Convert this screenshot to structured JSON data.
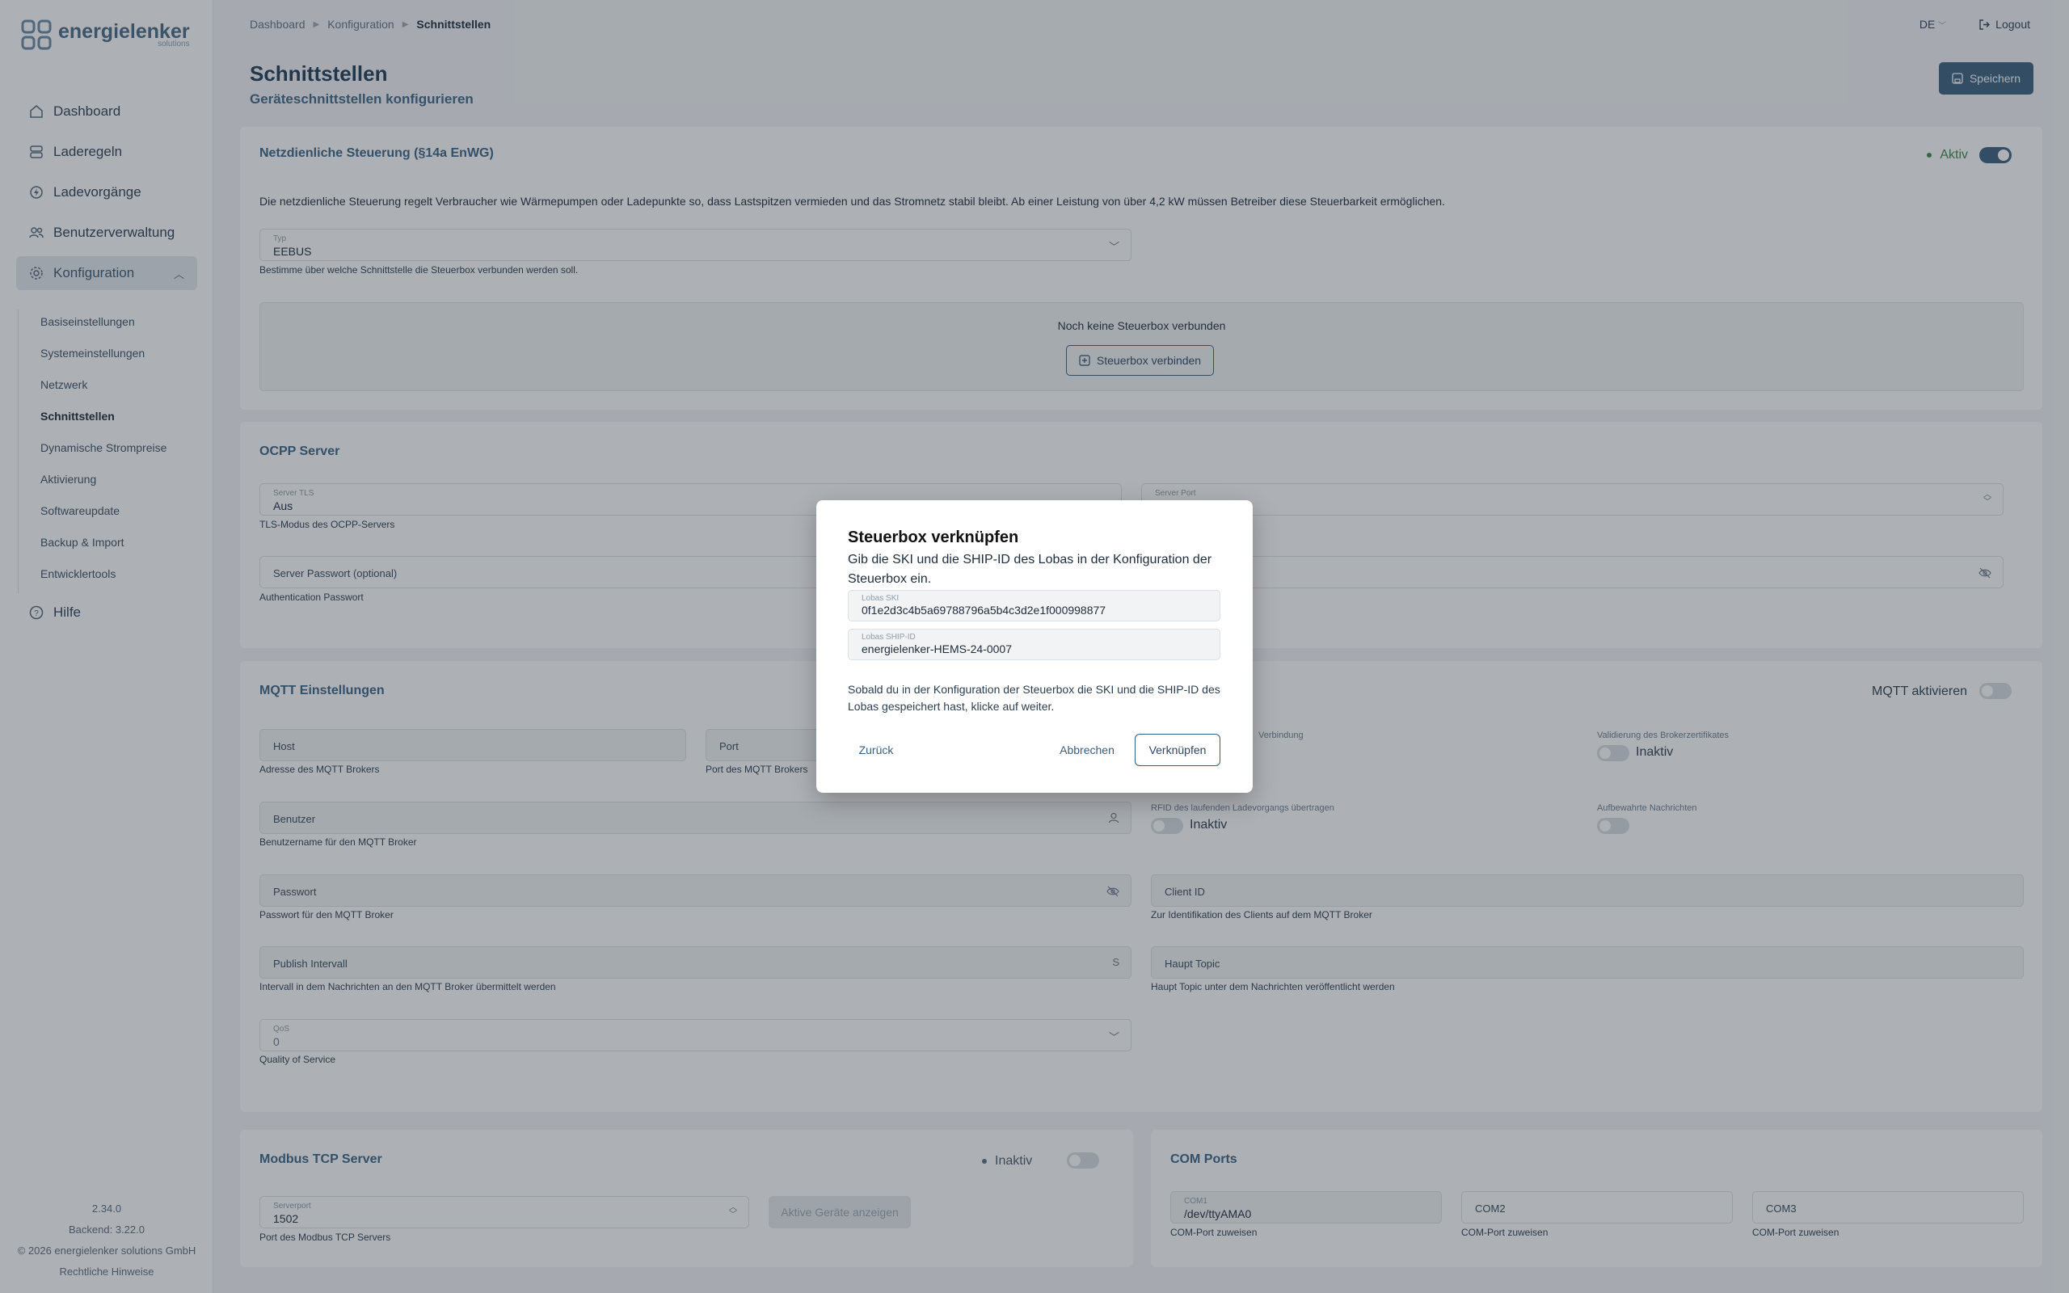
{
  "app": {
    "logo_name": "energielenker",
    "logo_sub": "solutions"
  },
  "nav": {
    "items": [
      {
        "label": "Dashboard"
      },
      {
        "label": "Laderegeln"
      },
      {
        "label": "Ladevorgänge"
      },
      {
        "label": "Benutzerverwaltung"
      },
      {
        "label": "Konfiguration"
      }
    ],
    "sub_items": [
      {
        "label": "Basiseinstellungen"
      },
      {
        "label": "Systemeinstellungen"
      },
      {
        "label": "Netzwerk"
      },
      {
        "label": "Schnittstellen"
      },
      {
        "label": "Dynamische Strompreise"
      },
      {
        "label": "Aktivierung"
      },
      {
        "label": "Softwareupdate"
      },
      {
        "label": "Backup & Import"
      },
      {
        "label": "Entwicklertools"
      }
    ],
    "help": "Hilfe"
  },
  "footer": {
    "version": "2.34.0",
    "backend": "Backend: 3.22.0",
    "copyright": "© 2026 energielenker solutions GmbH",
    "legal": "Rechtliche Hinweise"
  },
  "breadcrumb": [
    "Dashboard",
    "Konfiguration",
    "Schnittstellen"
  ],
  "topbar": {
    "lang": "DE",
    "logout": "Logout"
  },
  "page": {
    "title": "Schnittstellen",
    "subtitle": "Geräteschnittstellen konfigurieren",
    "save": "Speichern"
  },
  "netz": {
    "title": "Netzdienliche Steuerung (§14a EnWG)",
    "status": "Aktiv",
    "description": "Die netzdienliche Steuerung regelt Verbraucher wie Wärmepumpen oder Ladepunkte so, dass Lastspitzen vermieden und das Stromnetz stabil bleibt. Ab einer Leistung von über 4,2 kW müssen Betreiber diese Steuerbarkeit ermöglichen.",
    "type_label": "Typ",
    "type_value": "EEBUS",
    "type_hint": "Bestimme über welche Schnittstelle die Steuerbox verbunden werden soll.",
    "empty_text": "Noch keine Steuerbox verbunden",
    "connect_button": "Steuerbox verbinden"
  },
  "ocpp": {
    "title": "OCPP Server",
    "tls_label": "Server TLS",
    "tls_value": "Aus",
    "tls_hint": "TLS-Modus des OCPP-Servers",
    "port_label": "Server Port",
    "password_placeholder": "Server Passwort (optional)",
    "password_hint": "Authentication Passwort"
  },
  "mqtt": {
    "title": "MQTT Einstellungen",
    "toggle_label": "MQTT aktivieren",
    "host": "Host",
    "host_hint": "Adresse des MQTT Brokers",
    "port": "Port",
    "port_hint": "Port des MQTT Brokers",
    "tls_label": "Verbindung",
    "validation_label": "Validierung des Brokerzertifikates",
    "validation_value": "Inaktiv",
    "user": "Benutzer",
    "user_hint": "Benutzername für den MQTT Broker",
    "rfid_label": "RFID des laufenden Ladevorgangs übertragen",
    "rfid_value": "Inaktiv",
    "retained_label": "Aufbewahrte Nachrichten",
    "password": "Passwort",
    "password_hint": "Passwort für den MQTT Broker",
    "client_id": "Client ID",
    "client_id_hint": "Zur Identifikation des Clients auf dem MQTT Broker",
    "publish": "Publish Intervall",
    "publish_unit": "S",
    "publish_hint": "Intervall in dem Nachrichten an den MQTT Broker übermittelt werden",
    "topic": "Haupt Topic",
    "topic_hint": "Haupt Topic unter dem Nachrichten veröffentlicht werden",
    "qos_label": "QoS",
    "qos_value": "0",
    "qos_hint": "Quality of Service"
  },
  "modbus": {
    "title": "Modbus TCP Server",
    "status": "Inaktiv",
    "port_label": "Serverport",
    "port_value": "1502",
    "port_hint": "Port des Modbus TCP Servers",
    "devices_button": "Aktive Geräte anzeigen"
  },
  "com": {
    "title": "COM Ports",
    "com1_label": "COM1",
    "com1_value": "/dev/ttyAMA0",
    "com2": "COM2",
    "com3": "COM3",
    "hint": "COM-Port zuweisen"
  },
  "modal": {
    "title": "Steuerbox verknüpfen",
    "description": "Gib die SKI und die SHIP-ID des Lobas in der Konfiguration der Steuerbox ein.",
    "ski_label": "Lobas SKI",
    "ski_value": "0f1e2d3c4b5a69788796a5b4c3d2e1f000998877",
    "ship_label": "Lobas SHIP-ID",
    "ship_value": "energielenker-HEMS-24-0007",
    "info": "Sobald du in der Konfiguration der Steuerbox die SKI und die SHIP-ID des Lobas gespeichert hast, klicke auf weiter.",
    "back": "Zurück",
    "cancel": "Abbrechen",
    "confirm": "Verknüpfen"
  }
}
